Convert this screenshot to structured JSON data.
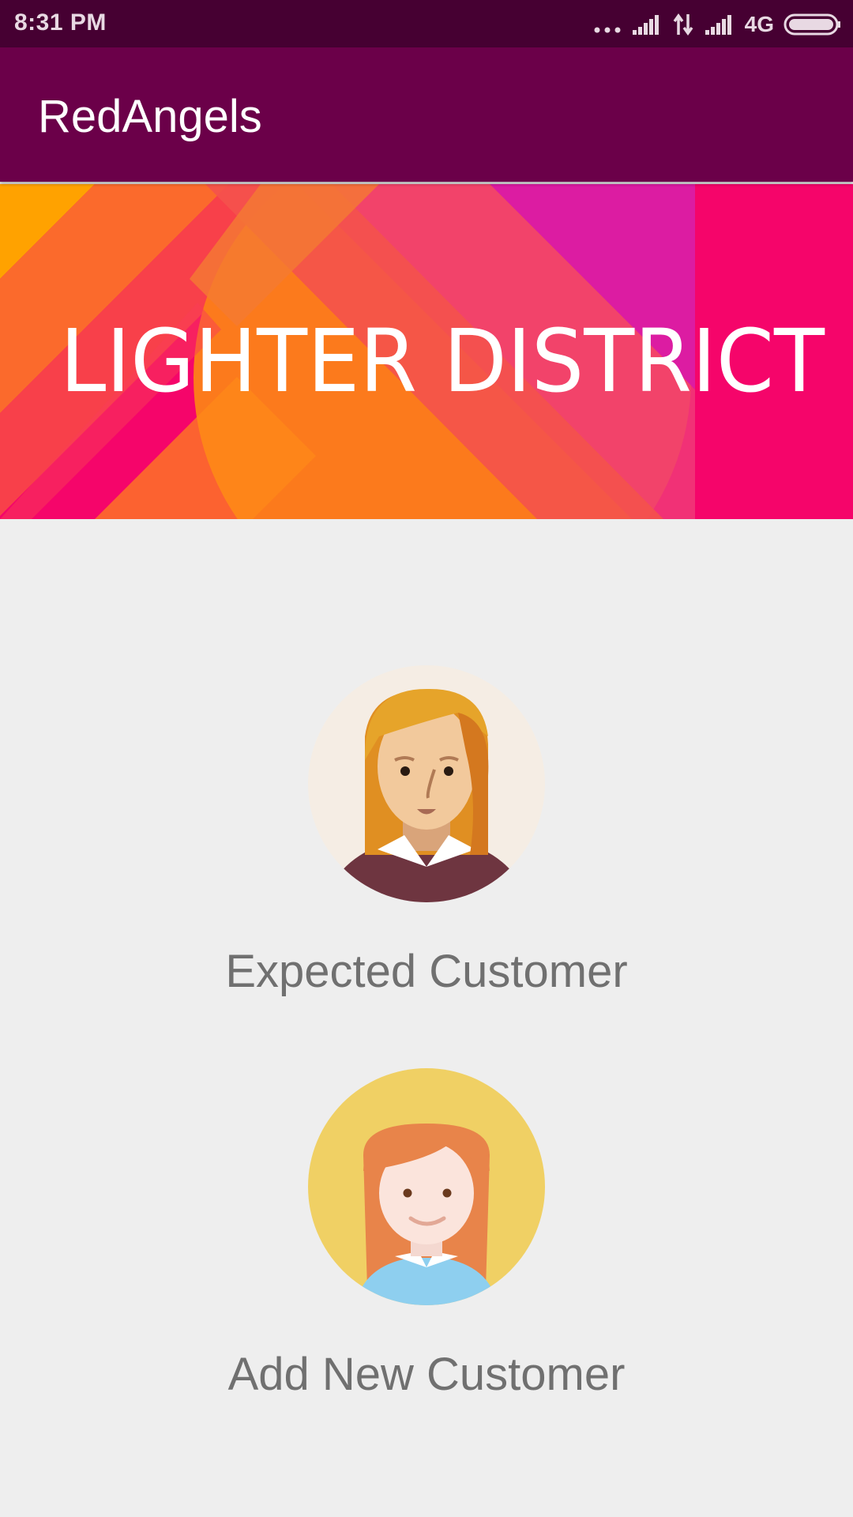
{
  "status_bar": {
    "time": "8:31 PM",
    "network_label": "4G",
    "icons": [
      "more-dots-icon",
      "signal-icon",
      "data-transfer-icon",
      "signal-icon",
      "battery-icon"
    ]
  },
  "app_bar": {
    "title": "RedAngels"
  },
  "banner": {
    "text": "LIGHTER DISTRICT"
  },
  "options": [
    {
      "label": "Expected Customer",
      "icon": "woman-avatar-icon"
    },
    {
      "label": "Add New Customer",
      "icon": "girl-avatar-icon"
    }
  ],
  "colors": {
    "status_bar": "#460032",
    "app_bar": "#6b0049",
    "background": "#eeeeee",
    "label_text": "#707070"
  }
}
